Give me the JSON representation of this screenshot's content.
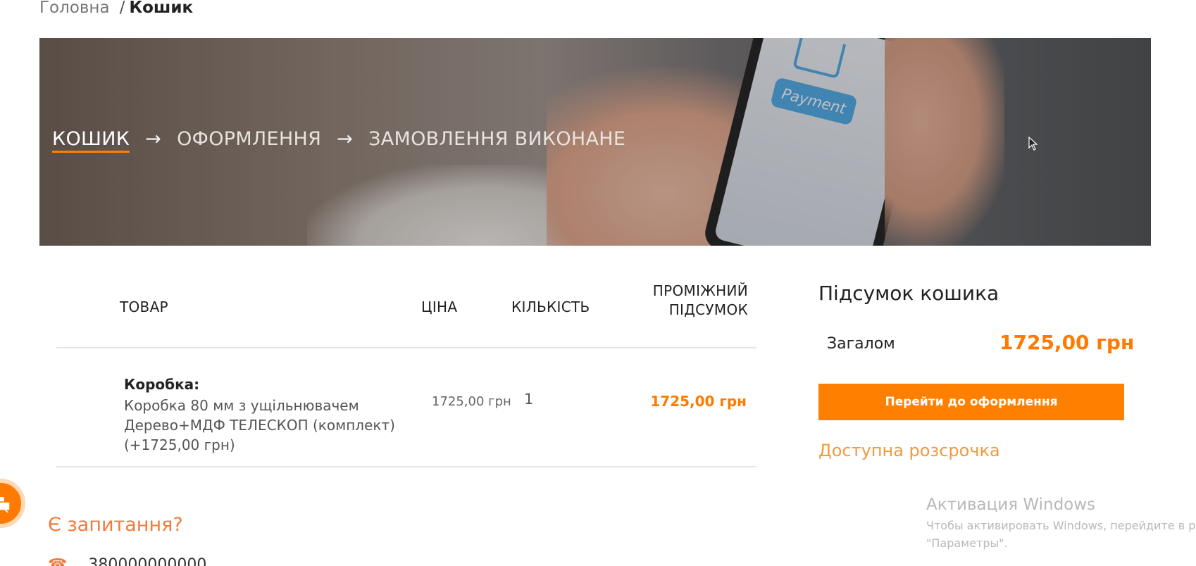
{
  "breadcrumb": {
    "home": "Головна",
    "separator": "/",
    "current": "Кошик"
  },
  "hero": {
    "steps": [
      "КОШИК",
      "ОФОРМЛЕННЯ",
      "ЗАМОВЛЕННЯ ВИКОНАНЕ"
    ],
    "arrow": "→",
    "active_step": 0,
    "image_text": "Payment"
  },
  "cart_table": {
    "columns": {
      "product": "ТОВАР",
      "price": "ЦІНА",
      "quantity": "КІЛЬКІСТЬ",
      "subtotal_line1": "ПРОМІЖНИЙ",
      "subtotal_line2": "ПІДСУМОК"
    },
    "items": [
      {
        "name": "Коробка:",
        "description": "Коробка 80 мм з ущільнювачем Дерево+МДФ ТЕЛЕСКОП (комплект) (+1725,00 грн)",
        "price": "1725,00 грн",
        "quantity": "1",
        "subtotal": "1725,00 грн"
      }
    ]
  },
  "summary": {
    "title": "Підсумок кошика",
    "total_label": "Загалом",
    "total_value": "1725,00 грн",
    "checkout_button": "Перейти до оформлення",
    "installment_link": "Доступна розсрочка"
  },
  "questions": {
    "title": "Є запитання?",
    "phone": "380000000000"
  },
  "watermark": {
    "title": "Активация Windows",
    "line1": "Чтобы активировать Windows, перейдите в раздел",
    "line2": "\"Параметры\"."
  },
  "colors": {
    "accent": "#ff8000",
    "accent_text": "#ff7a00",
    "link": "#f29a3c",
    "questions": "#f07a3c"
  }
}
